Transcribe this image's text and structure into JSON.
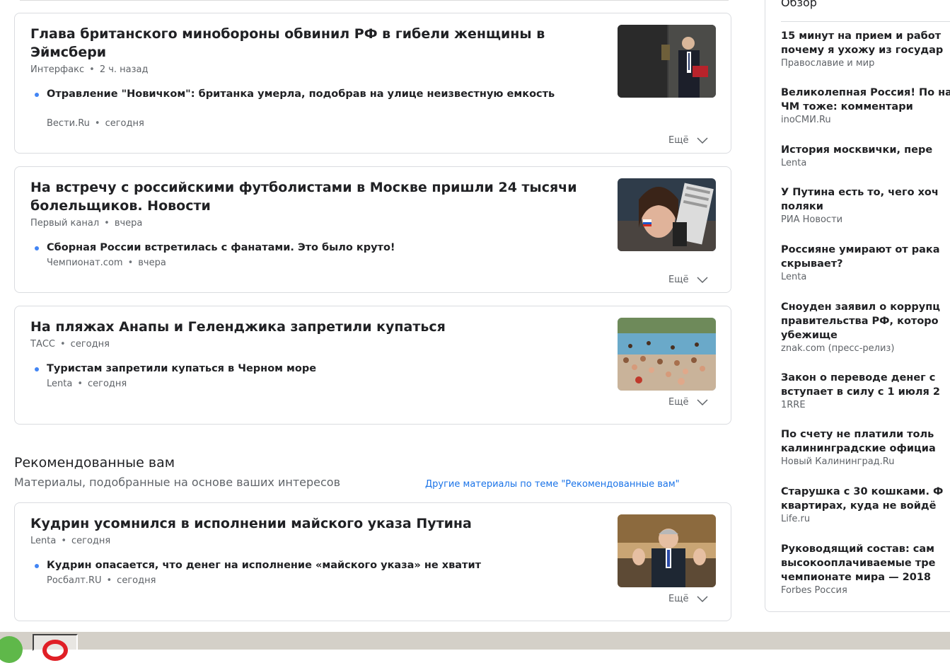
{
  "articles": [
    {
      "title": "Глава британского минобороны обвинил РФ в гибели женщины в Эймсбери",
      "source": "Интерфакс",
      "time": "2 ч. назад",
      "related_title": "Отравление \"Новичком\": британка умерла, подобрав на улице неизвестную емкость",
      "related_source": "Вести.Ru",
      "related_time": "сегодня",
      "more_label": "Ещё"
    },
    {
      "title": "На встречу с российскими футболистами в Москве пришли 24 тысячи болельщиков. Новости",
      "source": "Первый канал",
      "time": "вчера",
      "related_title": "Сборная России встретилась с фанатами. Это было круто!",
      "related_source": "Чемпионат.com",
      "related_time": "вчера",
      "more_label": "Ещё"
    },
    {
      "title": "На пляжах Анапы и Геленджика запретили купаться",
      "source": "ТАСС",
      "time": "сегодня",
      "related_title": "Туристам запретили купаться в Черном море",
      "related_source": "Lenta",
      "related_time": "сегодня",
      "more_label": "Ещё"
    }
  ],
  "recommended": {
    "heading": "Рекомендованные вам",
    "subheading": "Материалы, подобранные на основе ваших интересов",
    "link": "Другие материалы по теме \"Рекомендованные вам\"",
    "article": {
      "title": "Кудрин усомнился в исполнении майского указа Путина",
      "source": "Lenta",
      "time": "сегодня",
      "related_title": "Кудрин опасается, что денег на исполнение «майского указа» не хватит",
      "related_source": "Росбалт.RU",
      "related_time": "сегодня",
      "more_label": "Ещё"
    }
  },
  "sidebar": {
    "heading": "Обзор",
    "items": [
      {
        "title": "15 минут на прием и работ почему я ухожу из государ",
        "source": "Православие и мир"
      },
      {
        "title": "Великолепная Россия! По на ЧМ тоже: комментари",
        "source": "inoСМИ.Ru"
      },
      {
        "title": "История москвички, пере",
        "source": "Lenta"
      },
      {
        "title": "У Путина есть то, чего хоч поляки",
        "source": "РИА Новости"
      },
      {
        "title": "Россияне умирают от рака скрывает?",
        "source": "Lenta"
      },
      {
        "title": "Сноуден заявил о коррупц правительства РФ, которо убежище",
        "source": "znak.com (пресс-релиз)"
      },
      {
        "title": "Закон о переводе денег с вступает в силу с 1 июля 2",
        "source": "1RRE"
      },
      {
        "title": "По счету не платили толь калининградские официа",
        "source": "Новый Калининград.Ru"
      },
      {
        "title": "Старушка с 30 кошками. Ф квартирах, куда не войдё",
        "source": "Life.ru"
      },
      {
        "title": "Руководящий состав: сам высокооплачиваемые тре чемпионате мира — 2018",
        "source": "Forbes Россия"
      }
    ]
  },
  "colors": {
    "accent_link": "#1a73e8",
    "bullet": "#4285f4",
    "border": "#dadce0",
    "opera_red": "#e01f26"
  },
  "icons": {
    "more": "chevron-down-icon",
    "taskbar_app": "green-app-icon",
    "taskbar_browser": "opera-icon"
  }
}
